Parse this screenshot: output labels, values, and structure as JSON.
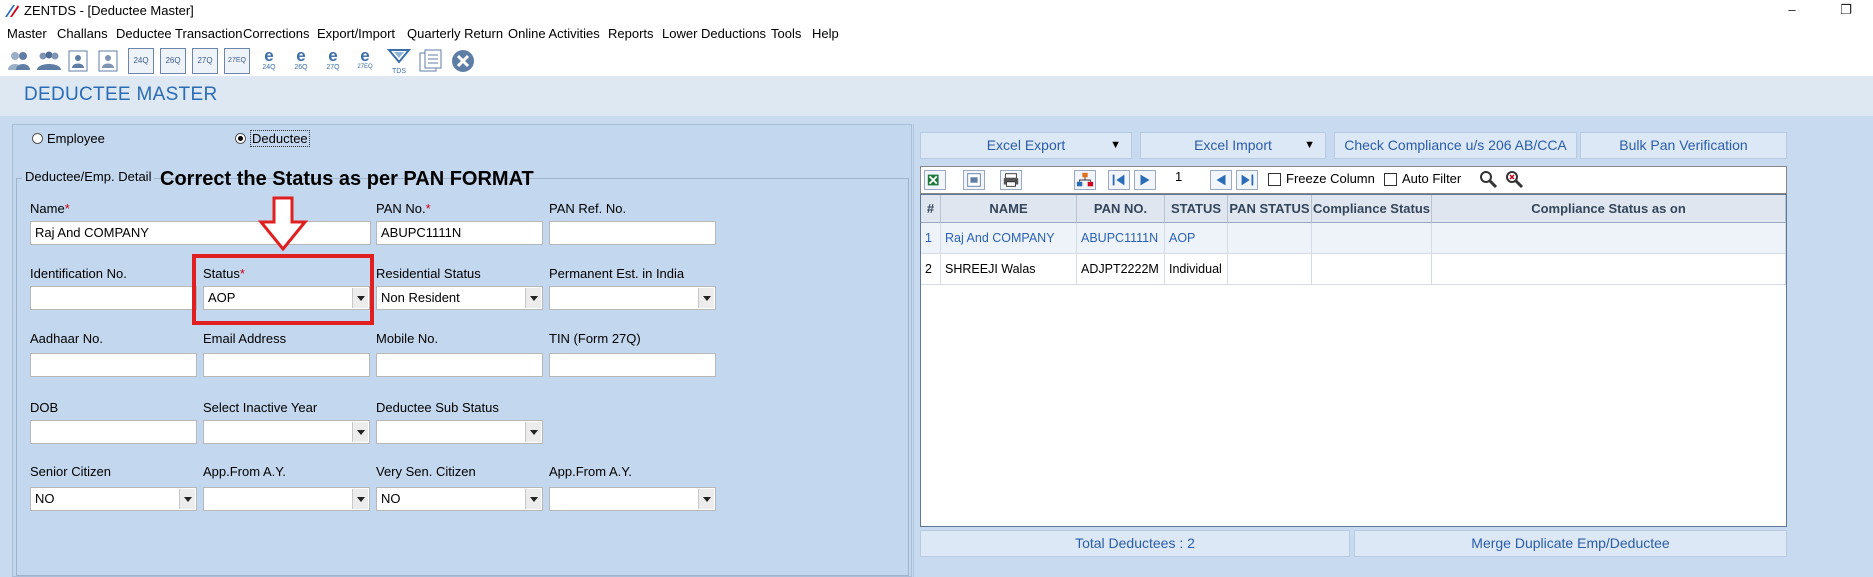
{
  "window": {
    "title": "ZENTDS - [Deductee Master]",
    "min_glyph": "–",
    "max_glyph": "❐"
  },
  "menu": [
    "Master",
    "Challans",
    "Deductee Transaction",
    "Corrections",
    "Export/Import",
    "Quarterly Return",
    "Online Activities",
    "Reports",
    "Lower Deductions",
    "Tools",
    "Help"
  ],
  "toolbar_labels": {
    "f24q": "24Q",
    "f26q": "26Q",
    "f27q": "27Q",
    "f27eq": "27EQ",
    "e24q": "24Q",
    "e26q": "26Q",
    "e27q": "27Q",
    "e27eq": "27EQ",
    "tds": "TDS"
  },
  "page_title": "DEDUCTEE MASTER",
  "radio": {
    "employee": "Employee",
    "deductee": "Deductee",
    "selected": "deductee"
  },
  "group_title": "Deductee/Emp. Detail",
  "annotation": "Correct the Status as per PAN FORMAT",
  "form": {
    "name_label": "Name",
    "name_value": "Raj And COMPANY",
    "pan_label": "PAN No.",
    "pan_value": "ABUPC1111N",
    "panref_label": "PAN Ref. No.",
    "panref_value": "",
    "idno_label": "Identification No.",
    "idno_value": "",
    "status_label": "Status",
    "status_value": "AOP",
    "resstatus_label": "Residential Status",
    "resstatus_value": "Non Resident",
    "perm_label": "Permanent Est. in India",
    "perm_value": "",
    "aadhaar_label": "Aadhaar No.",
    "aadhaar_value": "",
    "email_label": "Email Address",
    "email_value": "",
    "mobile_label": "Mobile No.",
    "mobile_value": "",
    "tin_label": "TIN (Form 27Q)",
    "tin_value": "",
    "dob_label": "DOB",
    "dob_value": "",
    "inactive_label": "Select Inactive Year",
    "inactive_value": "",
    "substatus_label": "Deductee Sub Status",
    "substatus_value": "",
    "senior_label": "Senior Citizen",
    "senior_value": "NO",
    "appfrom1_label": "App.From A.Y.",
    "appfrom1_value": "",
    "vsenior_label": "Very Sen. Citizen",
    "vsenior_value": "NO",
    "appfrom2_label": "App.From A.Y.",
    "appfrom2_value": ""
  },
  "right": {
    "excel_export": "Excel Export",
    "excel_import": "Excel Import",
    "check_compliance": "Check Compliance u/s 206 AB/CCA",
    "bulk_pan": "Bulk Pan Verification",
    "dd_glyph": "▼",
    "page_no": "1",
    "freeze_column": "Freeze Column",
    "auto_filter": "Auto Filter"
  },
  "grid": {
    "headers": [
      "#",
      "NAME",
      "PAN NO.",
      "STATUS",
      "PAN STATUS",
      "Compliance Status",
      "Compliance Status as on"
    ],
    "rows": [
      [
        "1",
        "Raj And COMPANY",
        "ABUPC1111N",
        "AOP",
        "",
        "",
        ""
      ],
      [
        "2",
        "SHREEJI Walas",
        "ADJPT2222M",
        "Individual",
        "",
        "",
        ""
      ]
    ]
  },
  "footer": {
    "total": "Total Deductees : 2",
    "merge": "Merge Duplicate Emp/Deductee"
  },
  "colors": {
    "accent": "#2a6cb5",
    "annotation_red": "#e02020",
    "panel_bg": "#c8daef"
  }
}
